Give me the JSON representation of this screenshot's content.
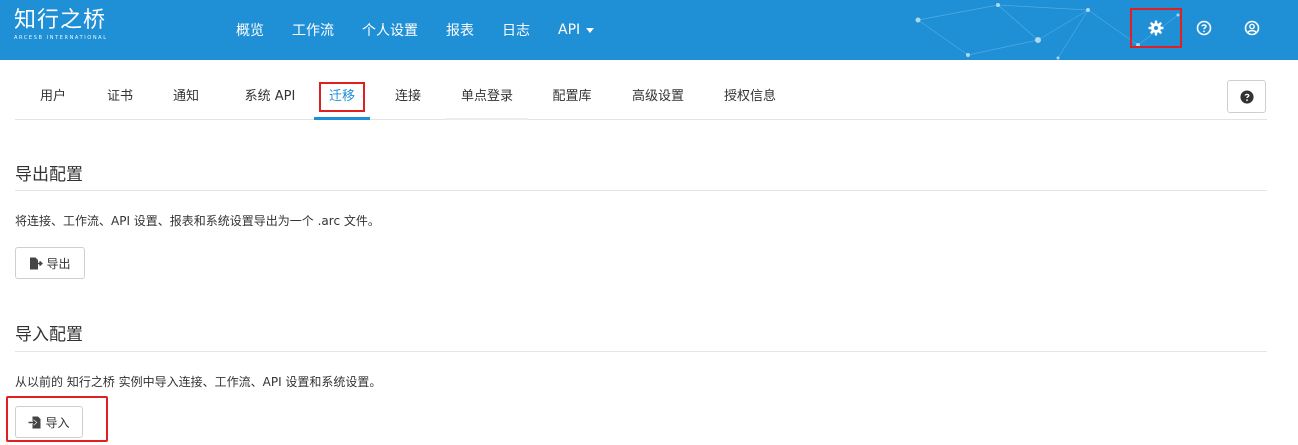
{
  "header": {
    "logo_text": "知行之桥",
    "logo_subtext": "ARCESB INTERNATIONAL",
    "nav": [
      {
        "label": "概览"
      },
      {
        "label": "工作流"
      },
      {
        "label": "个人设置"
      },
      {
        "label": "报表"
      },
      {
        "label": "日志"
      },
      {
        "label": "API"
      }
    ],
    "icons": [
      "gear-icon",
      "question-circle-icon",
      "user-circle-icon"
    ]
  },
  "tabs": [
    {
      "label": "用户"
    },
    {
      "label": "证书"
    },
    {
      "label": "通知"
    },
    {
      "label": "系统 API"
    },
    {
      "label": "迁移"
    },
    {
      "label": "连接"
    },
    {
      "label": "单点登录"
    },
    {
      "label": "配置库"
    },
    {
      "label": "高级设置"
    },
    {
      "label": "授权信息"
    }
  ],
  "export": {
    "title": "导出配置",
    "description": "将连接、工作流、API 设置、报表和系统设置导出为一个 .arc 文件。",
    "button": "导出"
  },
  "import": {
    "title": "导入配置",
    "description": "从以前的 知行之桥 实例中导入连接、工作流、API 设置和系统设置。",
    "button": "导入"
  },
  "colors": {
    "primary": "#1f8fd6",
    "highlight": "#e02020"
  }
}
